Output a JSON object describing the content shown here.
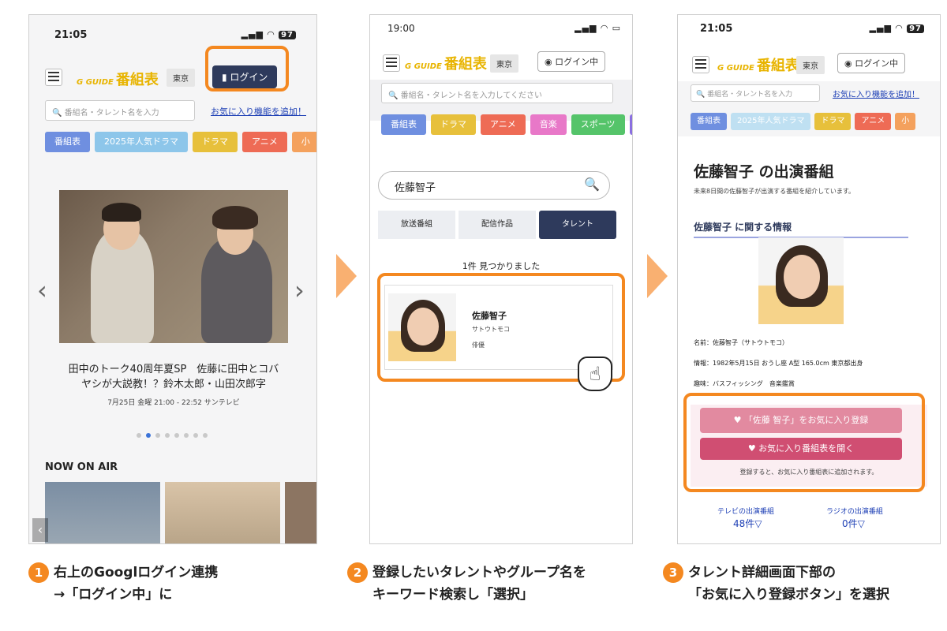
{
  "phone1": {
    "status_time": "21:05",
    "status_icons": "▐▌ ◠",
    "battery": "97",
    "logo_small": "G GUIDE",
    "logo_text": "番組表",
    "pref": "東京",
    "login_label": "ログイン",
    "search_placeholder": "番組名・タレント名を入力",
    "fav_link": "お気に入り機能を追加！",
    "tabs": [
      "番組表",
      "2025年人気ドラマ",
      "ドラマ",
      "アニメ",
      "小"
    ],
    "hero_title": "田中のトーク40周年夏SP　佐藤に田中とコバヤシが大説教！？鈴木太郎・山田次郎字",
    "hero_sub": "7月25日 金曜 21:00 - 22:52 サンテレビ",
    "now_on_air": "NOW ON AIR"
  },
  "phone2": {
    "status_time": "19:00",
    "logo_small": "G GUIDE",
    "logo_text": "番組表",
    "pref": "東京",
    "login_label": "ログイン中",
    "search_placeholder": "番組名・タレント名を入力してください",
    "tabs": [
      "番組表",
      "ドラマ",
      "アニメ",
      "音楽",
      "スポーツ"
    ],
    "query": "佐藤智子",
    "segments": [
      "放送番組",
      "配信作品",
      "タレント"
    ],
    "result_count": "1件 見つかりました",
    "result_name": "佐藤智子",
    "result_kana": "サトウトモコ",
    "result_role": "俳優"
  },
  "phone3": {
    "status_time": "21:05",
    "battery": "97",
    "logo_small": "G GUIDE",
    "logo_text": "番組表",
    "pref": "東京",
    "login_label": "ログイン中",
    "search_placeholder": "番組名・タレント名を入力",
    "fav_link": "お気に入り機能を追加！",
    "tabs": [
      "番組表",
      "2025年人気ドラマ",
      "ドラマ",
      "アニメ",
      "小"
    ],
    "page_title": "佐藤智子 の出演番組",
    "page_sub": "未来8日間の佐藤智子が出演する番組を紹介しています。",
    "info_heading": "佐藤智子 に関する情報",
    "info_name": "名前：佐藤智子（サトウトモコ）",
    "info_detail": "情報：1982年5月15日 おうし座 A型 165.0cm 東京都出身",
    "info_hobby": "趣味：バスフィッシング　音楽鑑賞",
    "fav_button": "♥ 「佐藤 智子」をお気に入り登録",
    "open_button": "♥ お気に入り番組表を開く",
    "note": "登録すると、お気に入り番組表に追加されます。",
    "tv_label": "テレビの出演番組",
    "tv_count": "48件▽",
    "radio_label": "ラジオの出演番組",
    "radio_count": "0件▽"
  },
  "captions": {
    "c1_line1": "右上のGooglログイン連携",
    "c1_line2": "→「ログイン中」に",
    "c2_line1": "登録したいタレントやグループ名を",
    "c2_line2": "キーワード検索し「選択」",
    "c3_line1": "タレント詳細画面下部の",
    "c3_line2": "「お気に入り登録ボタン」を選択",
    "n1": "1",
    "n2": "2",
    "n3": "3"
  },
  "colors": {
    "accent": "#f48820",
    "navy": "#2e3a5c",
    "pink": "#e07892",
    "logo": "#e8b400"
  }
}
